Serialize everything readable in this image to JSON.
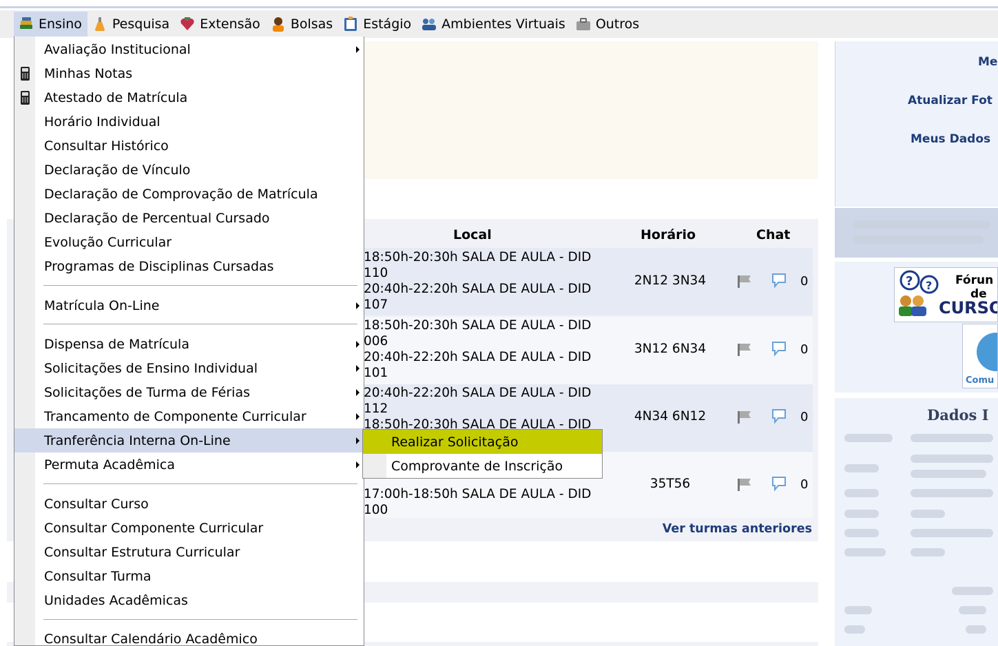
{
  "menubar": {
    "items": [
      {
        "label": "Ensino",
        "icon": "book-stack-icon"
      },
      {
        "label": "Pesquisa",
        "icon": "flask-icon"
      },
      {
        "label": "Extensão",
        "icon": "gift-heart-icon"
      },
      {
        "label": "Bolsas",
        "icon": "person-icon"
      },
      {
        "label": "Estágio",
        "icon": "clipboard-icon"
      },
      {
        "label": "Ambientes Virtuais",
        "icon": "people-group-icon"
      },
      {
        "label": "Outros",
        "icon": "briefcase-icon"
      }
    ]
  },
  "dropdown": {
    "items": [
      {
        "label": "Avaliação Institucional",
        "submenu": true
      },
      {
        "label": "Minhas Notas",
        "icon": "calculator-icon"
      },
      {
        "label": "Atestado de Matrícula",
        "icon": "calculator-icon"
      },
      {
        "label": "Horário Individual"
      },
      {
        "label": "Consultar Histórico"
      },
      {
        "label": "Declaração de Vínculo"
      },
      {
        "label": "Declaração de Comprovação de Matrícula"
      },
      {
        "label": "Declaração de Percentual Cursado"
      },
      {
        "label": "Evolução Curricular"
      },
      {
        "label": "Programas de Disciplinas Cursadas"
      },
      {
        "label": "Matrícula On-Line",
        "submenu": true
      },
      {
        "label": "Dispensa de Matrícula",
        "submenu": true
      },
      {
        "label": "Solicitações de Ensino Individual",
        "submenu": true
      },
      {
        "label": "Solicitações de Turma de Férias",
        "submenu": true
      },
      {
        "label": "Trancamento de Componente Curricular",
        "submenu": true
      },
      {
        "label": "Tranferência Interna On-Line",
        "submenu": true,
        "highlighted": true
      },
      {
        "label": "Permuta Acadêmica",
        "submenu": true
      },
      {
        "label": "Consultar Curso"
      },
      {
        "label": "Consultar Componente Curricular"
      },
      {
        "label": "Consultar Estrutura Curricular"
      },
      {
        "label": "Consultar Turma"
      },
      {
        "label": "Unidades Acadêmicas"
      },
      {
        "label": "Consultar Calendário Acadêmico"
      }
    ]
  },
  "submenu": {
    "items": [
      {
        "label": "Realizar Solicitação",
        "highlighted": true
      },
      {
        "label": "Comprovante de Inscrição"
      }
    ]
  },
  "table": {
    "headers": {
      "local": "Local",
      "horario": "Horário",
      "chat": "Chat"
    },
    "rows": [
      {
        "local": [
          "18:50h-20:30h SALA DE AULA - DID",
          "110",
          "20:40h-22:20h SALA DE AULA - DID",
          "107"
        ],
        "horario": "2N12 3N34",
        "count": "0"
      },
      {
        "local": [
          "18:50h-20:30h SALA DE AULA - DID",
          "006",
          "20:40h-22:20h SALA DE AULA - DID",
          "101"
        ],
        "horario": "3N12 6N34",
        "count": "0"
      },
      {
        "local": [
          "20:40h-22:20h SALA DE AULA - DID",
          "112",
          "18:50h-20:30h SALA DE AULA - DID"
        ],
        "horario": "4N34 6N12",
        "count": "0"
      },
      {
        "local": [
          "",
          "",
          "17:00h-18:50h SALA DE AULA - DID",
          "100"
        ],
        "horario": "35T56",
        "count": "0"
      }
    ],
    "ver_turmas": "Ver turmas anteriores"
  },
  "sidebar": {
    "links": [
      "Me",
      "Atualizar Fot",
      "Meus Dados"
    ],
    "forum": {
      "line1": "Fórun",
      "line2": "de",
      "line3": "CURSO"
    },
    "comu": "Comu",
    "dados_title": "Dados I"
  }
}
